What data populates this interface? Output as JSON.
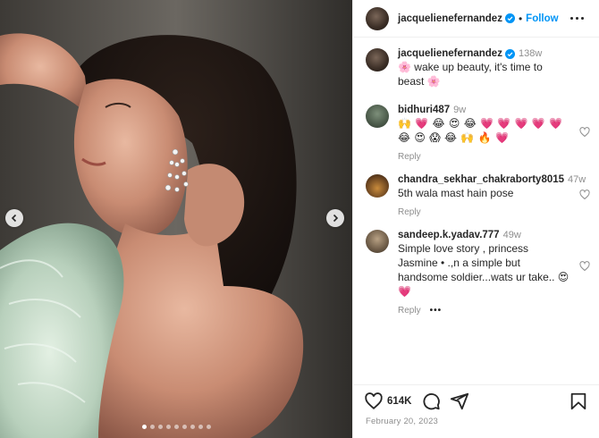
{
  "media": {
    "carousel_dots": 9,
    "active_dot": 0,
    "prev_icon": "chevron-left-icon",
    "next_icon": "chevron-right-icon"
  },
  "header": {
    "username": "jacquelienefernandez",
    "separator": "•",
    "follow_label": "Follow",
    "more_icon": "more-horizontal-icon"
  },
  "caption": {
    "username": "jacquelienefernandez",
    "time": "138w",
    "text": "🌸  wake up beauty, it's time to beast 🌸"
  },
  "comments": [
    {
      "username": "bidhuri487",
      "time": "9w",
      "text": "🙌 💗 😂 😍 😂 💗 💗 💗 💗 💗\n😂 😍 😱 😂 🙌 🔥 💗",
      "reply_label": "Reply"
    },
    {
      "username": "chandra_sekhar_chakraborty8015",
      "time": "47w",
      "text": "5th wala mast hain pose",
      "reply_label": "Reply"
    },
    {
      "username": "sandeep.k.yadav.777",
      "time": "49w",
      "text": "Simple love story , princess Jasmine •     .,n a simple but handsome soldier...wats ur take.. 😍 💗",
      "reply_label": "Reply",
      "more_label": "•••"
    }
  ],
  "actions": {
    "likes": "614K",
    "date": "February 20, 2023",
    "icons": [
      "heart-icon",
      "comment-icon",
      "share-icon",
      "bookmark-icon"
    ]
  },
  "colors": {
    "accent": "#0095f6",
    "text": "#262626",
    "muted": "#8e8e8e",
    "border": "#efefef"
  }
}
